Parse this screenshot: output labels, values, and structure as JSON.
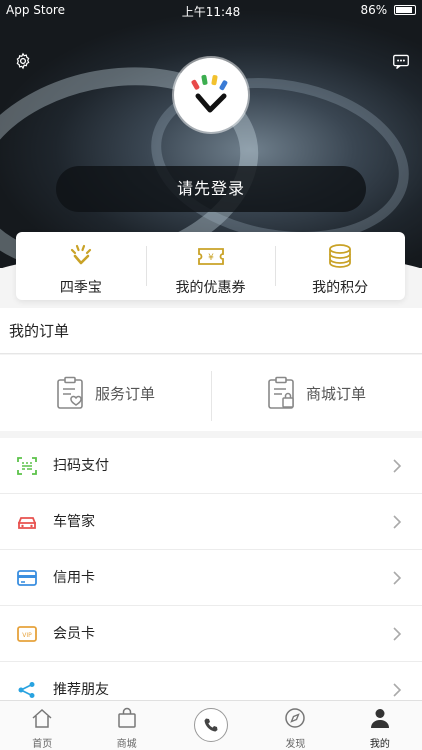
{
  "status_bar": {
    "carrier": "App Store",
    "time": "上午11:48",
    "battery": "86%"
  },
  "header": {
    "login_label": "请先登录"
  },
  "quick_links": [
    {
      "label": "四季宝",
      "icon": "sunburst-logo-icon"
    },
    {
      "label": "我的优惠券",
      "icon": "coupon-icon"
    },
    {
      "label": "我的积分",
      "icon": "coins-icon"
    }
  ],
  "orders": {
    "title": "我的订单",
    "items": [
      {
        "label": "服务订单",
        "icon": "service-order-icon"
      },
      {
        "label": "商城订单",
        "icon": "mall-order-icon"
      }
    ]
  },
  "menu": [
    {
      "label": "扫码支付",
      "icon": "scan-pay-icon",
      "color": "#5cc24a"
    },
    {
      "label": "车管家",
      "icon": "car-icon",
      "color": "#e8524f"
    },
    {
      "label": "信用卡",
      "icon": "credit-card-icon",
      "color": "#3b8fe0"
    },
    {
      "label": "会员卡",
      "icon": "vip-card-icon",
      "color": "#e6a23c"
    },
    {
      "label": "推荐朋友",
      "icon": "share-icon",
      "color": "#29a3e0"
    }
  ],
  "tabbar": [
    {
      "label": "首页",
      "icon": "home-icon"
    },
    {
      "label": "商城",
      "icon": "shopping-bag-icon"
    },
    {
      "label": "",
      "icon": "phone-icon"
    },
    {
      "label": "发现",
      "icon": "compass-icon"
    },
    {
      "label": "我的",
      "icon": "user-icon",
      "active": true
    }
  ],
  "accent_color": "#c9a227"
}
